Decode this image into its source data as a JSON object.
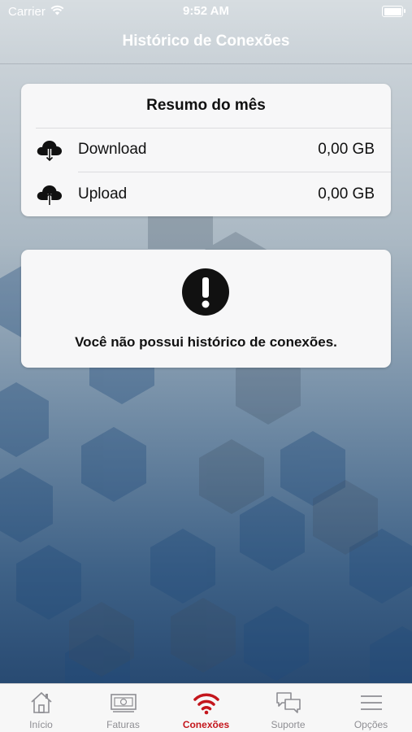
{
  "status_bar": {
    "carrier": "Carrier",
    "time": "9:52 AM",
    "battery": "battery-full-icon"
  },
  "nav": {
    "title": "Histórico de Conexões"
  },
  "summary": {
    "title": "Resumo do mês",
    "rows": [
      {
        "label": "Download",
        "value": "0,00 GB",
        "icon": "cloud-download-icon"
      },
      {
        "label": "Upload",
        "value": "0,00 GB",
        "icon": "cloud-upload-icon"
      }
    ]
  },
  "empty_state": {
    "icon": "exclamation-icon",
    "message": "Você não possui histórico de conexões."
  },
  "tabs": [
    {
      "label": "Início",
      "icon": "home-icon",
      "active": false
    },
    {
      "label": "Faturas",
      "icon": "bill-icon",
      "active": false
    },
    {
      "label": "Conexões",
      "icon": "wifi-icon",
      "active": true
    },
    {
      "label": "Suporte",
      "icon": "chat-bubbles-icon",
      "active": false
    },
    {
      "label": "Opções",
      "icon": "menu-icon",
      "active": false
    }
  ],
  "colors": {
    "accent": "#c4161c",
    "tab_inactive": "#8e8e93",
    "card": "#f7f7f8"
  }
}
